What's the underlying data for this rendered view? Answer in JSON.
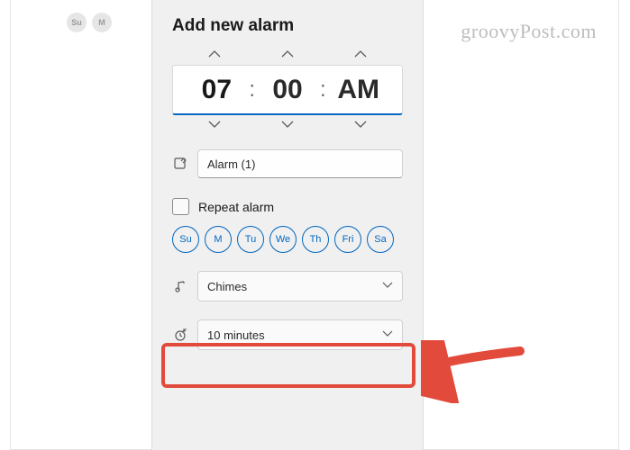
{
  "watermark": "groovyPost.com",
  "bgDays": {
    "d0": "Su",
    "d1": "M"
  },
  "title": "Add new alarm",
  "time": {
    "hour": "07",
    "minute": "00",
    "ampm": "AM"
  },
  "alarmName": "Alarm (1)",
  "repeatLabel": "Repeat alarm",
  "days": {
    "d0": "Su",
    "d1": "M",
    "d2": "Tu",
    "d3": "We",
    "d4": "Th",
    "d5": "Fri",
    "d6": "Sa"
  },
  "sound": "Chimes",
  "snooze": "10 minutes"
}
